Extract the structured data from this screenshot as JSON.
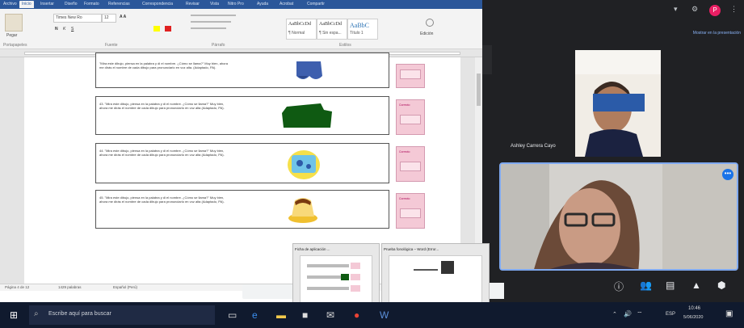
{
  "word": {
    "tabs": [
      "Archivo",
      "Inicio",
      "Insertar",
      "Diseño",
      "Formato",
      "Referencias",
      "Correspondencia",
      "Revisar",
      "Vista",
      "Nitro Pro",
      "Ayuda",
      "Acrobat",
      "Compartir"
    ],
    "active_tab": "Inicio",
    "font_name": "Times New Ro",
    "font_size": "12",
    "paste_label": "Pegar",
    "styles": [
      {
        "sample": "AaBbCcDd",
        "name": "¶ Normal"
      },
      {
        "sample": "AaBbCcDd",
        "name": "¶ Sin espa..."
      },
      {
        "sample": "AaBbC",
        "name": "Título 1"
      }
    ],
    "editing_label": "Edición",
    "group_labels": [
      "Portapapeles",
      "Fuente",
      "Párrafo",
      "Estilos"
    ],
    "cards": [
      {
        "text": "\"Mira este dibujo, piensa en la palabra y di el nombre. ¿Cómo se llama?\" Muy bien, ahora me dirás el nombre de cada dibujo para pronunciarlo en voz alta. (Adaptado, PA).",
        "picture": "pants"
      },
      {
        "text": "43. \"Mira este dibujo, piensa en la palabra y di el nombre. ¿Cómo se llama?\" Muy bien, ahora me dirás el nombre de cada dibujo para pronunciarlo en voz alta (Adaptado, PA).",
        "picture": "sofa"
      },
      {
        "text": "44. \"Mira este dibujo, piensa en la palabra y di el nombre. ¿Cómo se llama?\" Muy bien, ahora me dirás el nombre de cada dibujo para pronunciarlo en voz alta (Adaptado, PA).",
        "picture": "fishbowl"
      },
      {
        "text": "45. \"Mira este dibujo, piensa en la palabra y di el nombre. ¿Cómo se llama?\" Muy bien, ahora me dirás el nombre de cada dibujo para pronunciarlo en voz alta (Adaptado, PA).",
        "picture": "flan"
      }
    ],
    "pink_label": "Correcto",
    "status": {
      "page": "Página 4 de 12",
      "words": "1429 palabras",
      "lang": "Español (Perú)"
    }
  },
  "meet": {
    "present_banner": "Mostrar en la presentación",
    "participant_name": "Ashley Carrera Cayo",
    "controls": [
      "info-icon",
      "people-icon",
      "chat-icon",
      "shapes-icon",
      "lock-icon"
    ]
  },
  "taskbar": {
    "search_placeholder": "Escribe aquí para buscar",
    "thumbs": [
      {
        "title": "Ficha de aplicación ..."
      },
      {
        "title": "Prueba fonológica – Word (Error..."
      }
    ],
    "time": "10:46",
    "date": "5/06/2020",
    "lang": "ESP",
    "avatar_letter": "P"
  },
  "colors": {
    "word_blue": "#2b579a",
    "pink": "#f4c9d6",
    "meet_bg": "#202124",
    "taskbar": "#101a2e"
  }
}
